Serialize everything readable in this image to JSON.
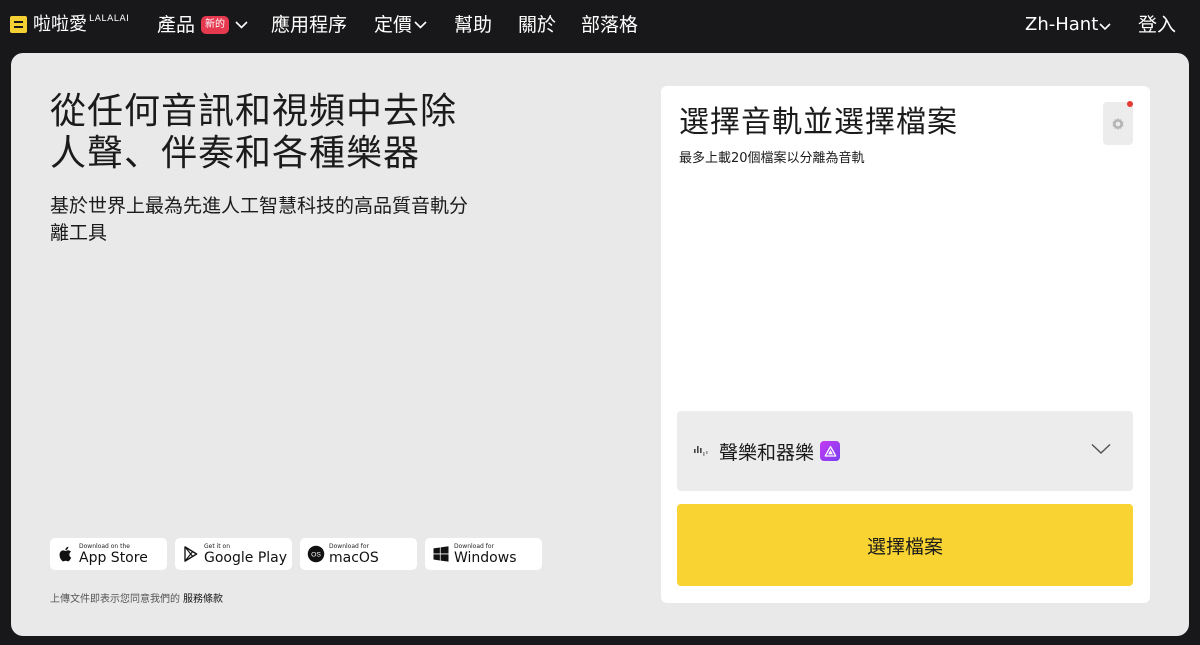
{
  "nav": {
    "logo_text": "啦啦愛",
    "logo_sup": "LALALAI",
    "items": [
      {
        "label": "產品",
        "badge": "新的"
      },
      {
        "label": "應用程序"
      },
      {
        "label": "定價"
      },
      {
        "label": "幫助"
      },
      {
        "label": "關於"
      },
      {
        "label": "部落格"
      }
    ],
    "language": "Zh-Hant",
    "login": "登入"
  },
  "hero": {
    "title_line1": "從任何音訊和視頻中去除",
    "title_line2": "人聲、伴奏和各種樂器",
    "subtitle": "基於世界上最為先進人工智慧科技的高品質音軌分離工具"
  },
  "stores": [
    {
      "small": "Download on the",
      "big": "App Store",
      "icon": "apple-icon"
    },
    {
      "small": "Get it on",
      "big": "Google Play",
      "icon": "google-play-icon"
    },
    {
      "small": "Download for",
      "big": "macOS",
      "icon": "macos-icon"
    },
    {
      "small": "Download for",
      "big": "Windows",
      "icon": "windows-icon"
    }
  ],
  "terms": {
    "text": "上傳文件即表示您同意我們的",
    "link": "服務條款"
  },
  "panel": {
    "title": "選擇音軌並選擇檔案",
    "subtitle": "最多上載20個檔案以分離為音軌",
    "stem_select": "聲樂和器樂",
    "choose_button": "選擇檔案"
  },
  "colors": {
    "background": "#18181a",
    "card": "#e9e9e9",
    "accent_yellow": "#f8d332",
    "badge_red": "#e53950",
    "pro_purple": "#b23af2"
  }
}
